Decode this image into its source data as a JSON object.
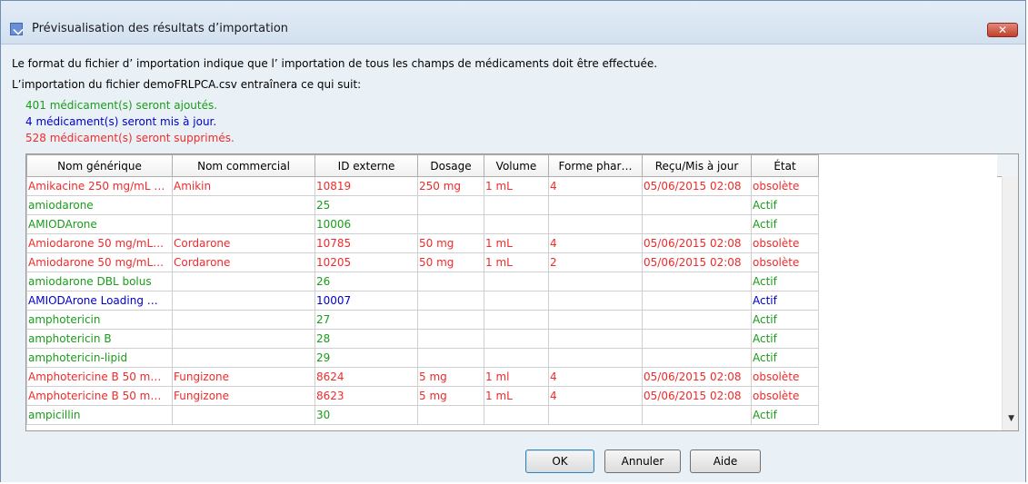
{
  "window": {
    "title": "Prévisualisation des résultats d’importation",
    "close_symbol": "✕"
  },
  "messages": {
    "format_notice": "Le format du fichier d’ importation indique que l’ importation de tous les champs de médicaments doit être effectuée.",
    "import_notice": "L’importation du fichier demoFRLPCA.csv entraînera ce qui suit:"
  },
  "summary": {
    "added": "401 médicament(s) seront ajoutés.",
    "updated": "4 médicament(s) seront mis à jour.",
    "deleted": "528 médicament(s) seront supprimés."
  },
  "colors": {
    "added": "#1a9c1a",
    "updated": "#0000c8",
    "deleted": "#f02a2a"
  },
  "table": {
    "columns": [
      "Nom générique",
      "Nom commercial",
      "ID externe",
      "Dosage",
      "Volume",
      "Forme phar…",
      "Reçu/Mis à jour",
      "État"
    ],
    "rows": [
      {
        "status": "deleted",
        "cells": [
          "Amikacine 250 mg/mL …",
          "Amikin",
          "10819",
          "250 mg",
          "1 mL",
          "4",
          "05/06/2015 02:08",
          "obsolète"
        ]
      },
      {
        "status": "added",
        "cells": [
          "amiodarone",
          "",
          "25",
          "",
          "",
          "",
          "",
          "Actif"
        ]
      },
      {
        "status": "added",
        "cells": [
          "AMIODArone",
          "",
          "10006",
          "",
          "",
          "",
          "",
          "Actif"
        ]
      },
      {
        "status": "deleted",
        "cells": [
          "Amiodarone 50 mg/mL…",
          "Cordarone",
          "10785",
          "50 mg",
          "1 mL",
          "4",
          "05/06/2015 02:08",
          "obsolète"
        ]
      },
      {
        "status": "deleted",
        "cells": [
          "Amiodarone 50 mg/mL…",
          "Cordarone",
          "10205",
          "50 mg",
          "1 mL",
          "2",
          "05/06/2015 02:08",
          "obsolète"
        ]
      },
      {
        "status": "added",
        "cells": [
          "amiodarone DBL bolus",
          "",
          "26",
          "",
          "",
          "",
          "",
          "Actif"
        ]
      },
      {
        "status": "updated",
        "cells": [
          "AMIODArone Loading …",
          "",
          "10007",
          "",
          "",
          "",
          "",
          "Actif"
        ]
      },
      {
        "status": "added",
        "cells": [
          "amphotericin",
          "",
          "27",
          "",
          "",
          "",
          "",
          "Actif"
        ]
      },
      {
        "status": "added",
        "cells": [
          "amphotericin B",
          "",
          "28",
          "",
          "",
          "",
          "",
          "Actif"
        ]
      },
      {
        "status": "added",
        "cells": [
          "amphotericin-lipid",
          "",
          "29",
          "",
          "",
          "",
          "",
          "Actif"
        ]
      },
      {
        "status": "deleted",
        "cells": [
          "Amphotericine B 50 m…",
          "Fungizone",
          "8624",
          "5 mg",
          "1 ml",
          "4",
          "05/06/2015 02:08",
          "obsolète"
        ]
      },
      {
        "status": "deleted",
        "cells": [
          "Amphotericine B 50 m…",
          "Fungizone",
          "8623",
          "5 mg",
          "1 mL",
          "4",
          "05/06/2015 02:08",
          "obsolète"
        ]
      },
      {
        "status": "added",
        "cells": [
          "ampicillin",
          "",
          "30",
          "",
          "",
          "",
          "",
          "Actif"
        ]
      }
    ]
  },
  "buttons": {
    "ok": "OK",
    "cancel": "Annuler",
    "help": "Aide"
  },
  "scrollbar": {
    "down_arrow": "▼"
  }
}
